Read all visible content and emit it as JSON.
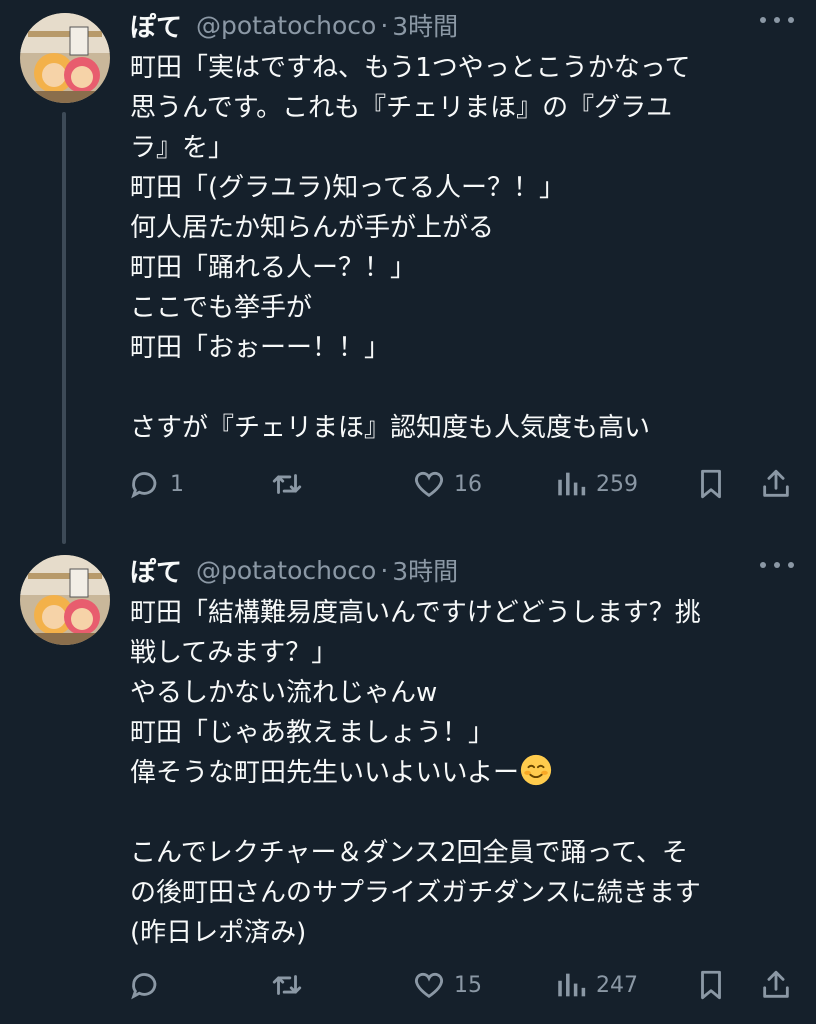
{
  "tweets": [
    {
      "author": {
        "name": "ぽて",
        "handle": "@potatochoco",
        "time": "3時間"
      },
      "lines": [
        "町田「実はですね、もう1つやっとこうかなって",
        "思うんです。これも『チェリまほ』の『グラユ",
        "ラ』を」",
        "町田「(グラユラ)知ってる人ー？！」",
        "何人居たか知らんが手が上がる",
        "町田「踊れる人ー？！」",
        "ここでも挙手が",
        "町田「おぉーー！！」",
        "",
        "さすが『チェリまほ』認知度も人気度も高い"
      ],
      "stats": {
        "replies": "1",
        "retweets": "",
        "likes": "16",
        "views": "259"
      }
    },
    {
      "author": {
        "name": "ぽて",
        "handle": "@potatochoco",
        "time": "3時間"
      },
      "lines": [
        "町田「結構難易度高いんですけどどうします？挑",
        "戦してみます？」",
        "やるしかない流れじゃんw",
        "町田「じゃあ教えましょう！」",
        "偉そうな町田先生いいよいいよー",
        "",
        "こんでレクチャー＆ダンス2回全員で踊って、そ",
        "の後町田さんのサプライズガチダンスに続きます",
        "(昨日レポ済み)"
      ],
      "emoji": "smiling-face-emoji",
      "stats": {
        "replies": "",
        "retweets": "",
        "likes": "15",
        "views": "247"
      }
    }
  ],
  "colors": {
    "background": "#15202b",
    "text": "#f7f9f9",
    "muted": "#8b98a5",
    "thread_line": "#3d4a57"
  },
  "icons": [
    "reply-icon",
    "retweet-icon",
    "like-icon",
    "views-icon",
    "bookmark-icon",
    "share-icon",
    "more-icon"
  ]
}
